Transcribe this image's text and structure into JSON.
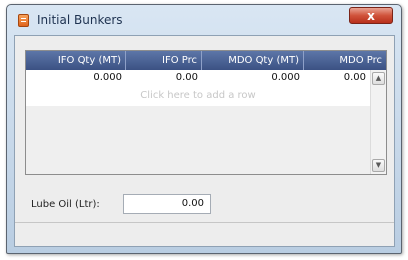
{
  "window": {
    "title": "Initial Bunkers",
    "close_label": "x"
  },
  "grid": {
    "columns": [
      "IFO Qty (MT)",
      "IFO Prc",
      "MDO Qty (MT)",
      "MDO Prc"
    ],
    "rows": [
      [
        "0.000",
        "0.00",
        "0.000",
        "0.00"
      ]
    ],
    "add_row_hint": "Click here to add a row"
  },
  "lube_oil": {
    "label": "Lube Oil (Ltr):",
    "value": "0.00"
  },
  "colors": {
    "header_bg": "#4a6396",
    "close_button": "#d0533b",
    "titlebar": "#c9daec"
  }
}
